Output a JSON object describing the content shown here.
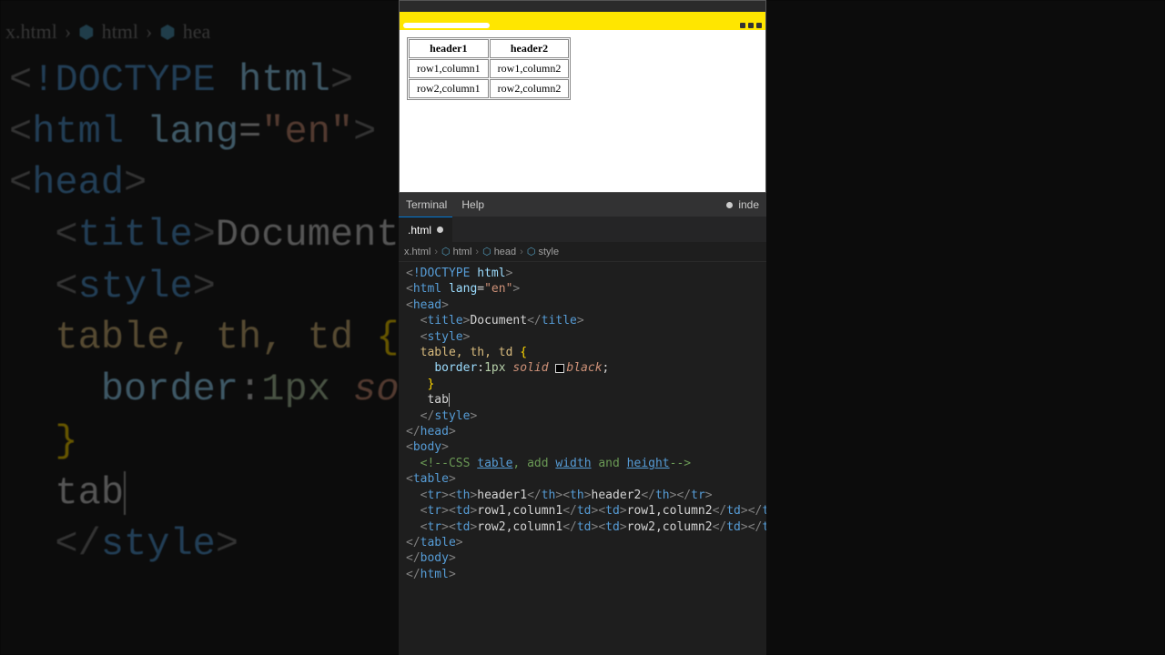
{
  "bg_breadcrumb": {
    "file": "x.html",
    "seg1": "html",
    "seg2": "hea"
  },
  "browser": {
    "address_text": "",
    "table": {
      "headers": [
        "header1",
        "header2"
      ],
      "rows": [
        [
          "row1,column1",
          "row1,column2"
        ],
        [
          "row2,column1",
          "row2,column2"
        ]
      ]
    }
  },
  "editor": {
    "menubar": {
      "terminal": "Terminal",
      "help": "Help",
      "right_label": "inde"
    },
    "tab": {
      "label": ".html"
    },
    "breadcrumb": {
      "seg0": "x.html",
      "seg1": "html",
      "seg2": "head",
      "seg3": "style"
    },
    "code": {
      "l1_doctype_excl": "!",
      "l1_doctype": "DOCTYPE",
      "l1_html": "html",
      "l2_tag": "html",
      "l2_attr": "lang",
      "l2_val": "\"en\"",
      "l3_tag": "head",
      "l4_tag": "title",
      "l4_text": "Document",
      "l5_tag": "style",
      "l6_sel": "table, th, td",
      "l7_prop": "border",
      "l7_num": "1px",
      "l7_v1": "solid",
      "l7_v2": "black",
      "l9_partial": "tab",
      "l10_tag": "style",
      "l11_tag": "head",
      "l12_tag": "body",
      "l13_com_pre": "<!--CSS ",
      "l13_kw": "table",
      "l13_mid": ", add ",
      "l13_kw2": "width",
      "l13_mid2": " and ",
      "l13_kw3": "height",
      "l13_suf": "-->",
      "l14_tag": "table",
      "l15_tr": "tr",
      "l15_th": "th",
      "l15_c1": "header1",
      "l15_c2": "header2",
      "l16_td": "td",
      "l16_c1": "row1,column1",
      "l16_c2": "row1,column2",
      "l17_c1": "row2,column1",
      "l17_c2": "row2,column2",
      "l18_tag": "table",
      "l19_tag": "body",
      "l20_tag": "html"
    }
  }
}
